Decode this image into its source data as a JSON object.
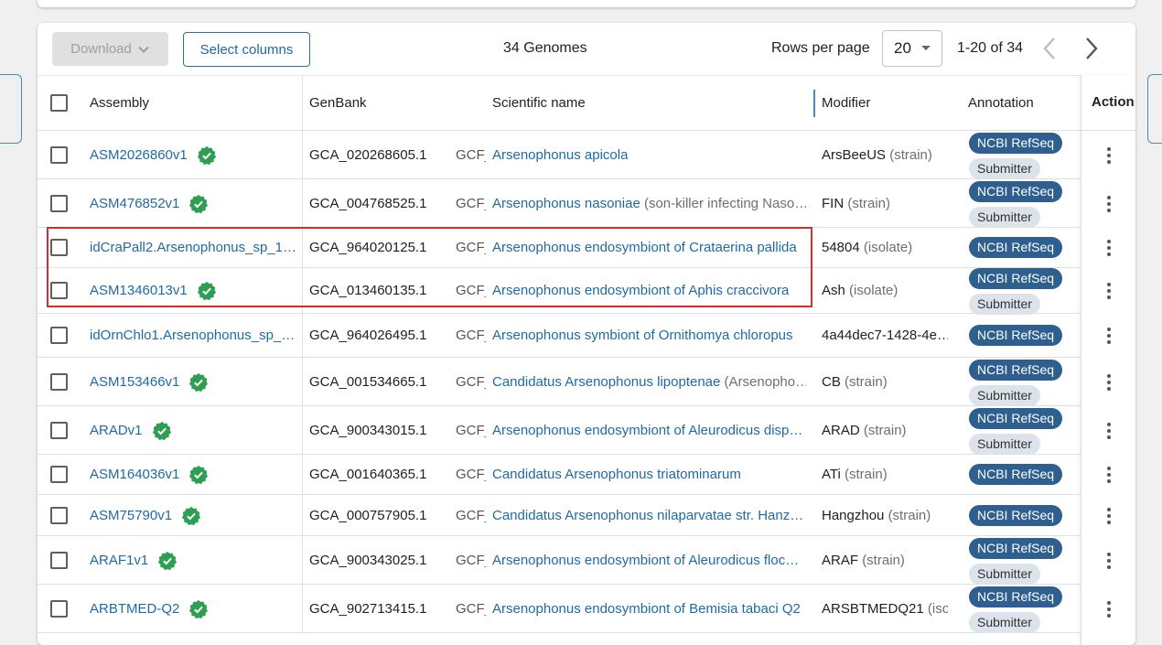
{
  "toolbar": {
    "download_label": "Download",
    "select_columns_label": "Select columns",
    "genome_count": "34 Genomes",
    "rows_per_page_label": "Rows per page",
    "rows_per_page_value": "20",
    "range_label": "1-20 of 34"
  },
  "columns": {
    "assembly": "Assembly",
    "genbank": "GenBank",
    "scientific_name": "Scientific name",
    "modifier": "Modifier",
    "annotation": "Annotation",
    "action": "Action"
  },
  "badges": {
    "refseq": "NCBI RefSeq",
    "submitter": "Submitter"
  },
  "rows": [
    {
      "assembly": "ASM2026860v1",
      "verified": true,
      "genbank": "GCA_020268605.1",
      "gcf": "GCF_",
      "name": "Arsenophonus apicola",
      "name_extra": "",
      "modifier": "ArsBeeUS",
      "modifier_type": "(strain)",
      "refseq": true,
      "submitter": true
    },
    {
      "assembly": "ASM476852v1",
      "verified": true,
      "genbank": "GCA_004768525.1",
      "gcf": "GCF_",
      "name": "Arsenophonus nasoniae",
      "name_extra": "(son-killer infecting Naso…",
      "modifier": "FIN",
      "modifier_type": "(strain)",
      "refseq": true,
      "submitter": true
    },
    {
      "assembly": "idCraPall2.Arsenophonus_sp_1…",
      "verified": false,
      "genbank": "GCA_964020125.1",
      "gcf": "GCF_",
      "name": "Arsenophonus endosymbiont of Crataerina pallida",
      "name_extra": "",
      "modifier": "54804",
      "modifier_type": "(isolate)",
      "refseq": true,
      "submitter": false
    },
    {
      "assembly": "ASM1346013v1",
      "verified": true,
      "genbank": "GCA_013460135.1",
      "gcf": "GCF_",
      "name": "Arsenophonus endosymbiont of Aphis craccivora",
      "name_extra": "",
      "modifier": "Ash",
      "modifier_type": "(isolate)",
      "refseq": true,
      "submitter": true
    },
    {
      "assembly": "idOrnChlo1.Arsenophonus_sp_…",
      "verified": false,
      "genbank": "GCA_964026495.1",
      "gcf": "GCF_",
      "name": "Arsenophonus symbiont of Ornithomya chloropus",
      "name_extra": "",
      "modifier": "4a44dec7-1428-4e…",
      "modifier_type": "",
      "refseq": true,
      "submitter": false
    },
    {
      "assembly": "ASM153466v1",
      "verified": true,
      "genbank": "GCA_001534665.1",
      "gcf": "GCF_",
      "name": "Candidatus Arsenophonus lipoptenae",
      "name_extra": "(Arsenopho…",
      "modifier": "CB",
      "modifier_type": "(strain)",
      "refseq": true,
      "submitter": true
    },
    {
      "assembly": "ARADv1",
      "verified": true,
      "genbank": "GCA_900343015.1",
      "gcf": "GCF_",
      "name": "Arsenophonus endosymbiont of Aleurodicus disp…",
      "name_extra": "",
      "modifier": "ARAD",
      "modifier_type": "(strain)",
      "refseq": true,
      "submitter": true
    },
    {
      "assembly": "ASM164036v1",
      "verified": true,
      "genbank": "GCA_001640365.1",
      "gcf": "GCF_",
      "name": "Candidatus Arsenophonus triatominarum",
      "name_extra": "",
      "modifier": "ATi",
      "modifier_type": "(strain)",
      "refseq": true,
      "submitter": false
    },
    {
      "assembly": "ASM75790v1",
      "verified": true,
      "genbank": "GCA_000757905.1",
      "gcf": "GCF_",
      "name": "Candidatus Arsenophonus nilaparvatae str. Hanz…",
      "name_extra": "",
      "modifier": "Hangzhou",
      "modifier_type": "(strain)",
      "refseq": true,
      "submitter": false
    },
    {
      "assembly": "ARAF1v1",
      "verified": true,
      "genbank": "GCA_900343025.1",
      "gcf": "GCF_",
      "name": "Arsenophonus endosymbiont of Aleurodicus floc…",
      "name_extra": "",
      "modifier": "ARAF",
      "modifier_type": "(strain)",
      "refseq": true,
      "submitter": true
    },
    {
      "assembly": "ARBTMED-Q2",
      "verified": true,
      "genbank": "GCA_902713415.1",
      "gcf": "GCF_",
      "name": "Arsenophonus endosymbiont of Bemisia tabaci Q2",
      "name_extra": "",
      "modifier": "ARSBTMEDQ21",
      "modifier_type": "(iso…",
      "refseq": true,
      "submitter": true
    }
  ],
  "colors": {
    "link": "#1f6aa5",
    "refseq_badge": "#2e5f8f",
    "submitter_badge": "#dde3ea",
    "verified": "#2e9e52",
    "highlight": "#d32f2f"
  },
  "icons": {
    "verified": "verified-check-icon",
    "dropdown": "chevron-down-icon",
    "prev": "chevron-left-icon",
    "next": "chevron-right-icon",
    "action": "more-vertical-icon"
  }
}
